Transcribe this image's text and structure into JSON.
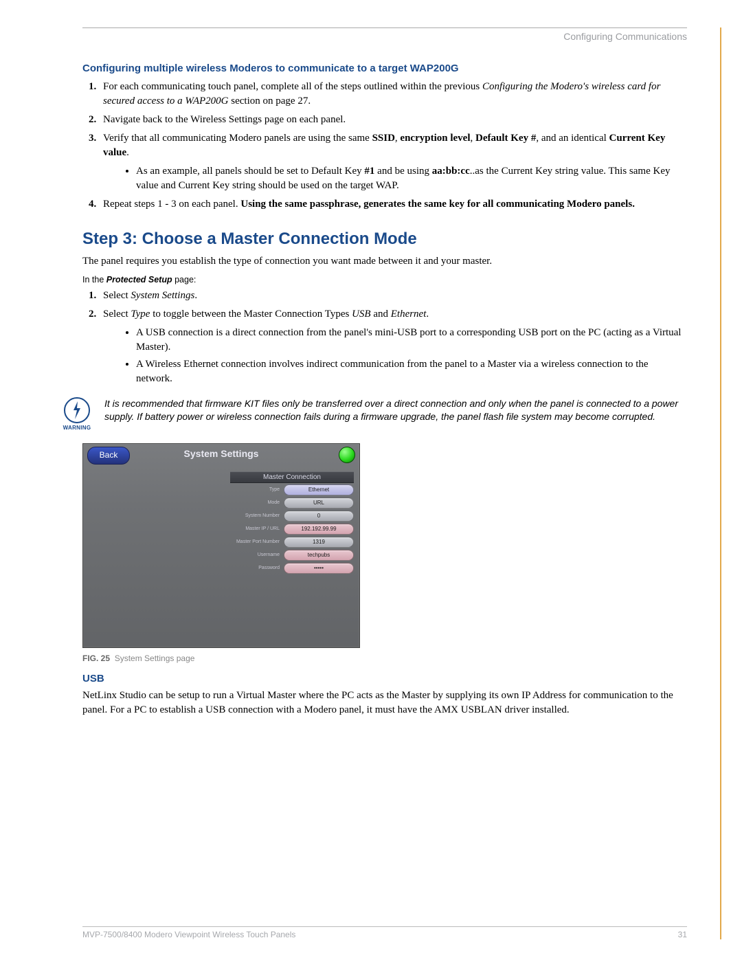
{
  "header": {
    "section": "Configuring Communications"
  },
  "headings": {
    "config_multi": "Configuring multiple wireless Moderos to communicate to a target WAP200G",
    "step3": "Step 3: Choose a Master Connection Mode",
    "usb": "USB"
  },
  "list1": {
    "item1_a": "For each communicating touch panel, complete all of the steps outlined within the previous ",
    "item1_b": "Configuring the Modero's wireless card for secured access to a WAP200G",
    "item1_c": " section on page 27.",
    "item2": "Navigate back to the Wireless Settings page on each panel.",
    "item3_a": "Verify that all communicating Modero panels are using the same ",
    "item3_b": "SSID",
    "item3_c": ", ",
    "item3_d": "encryption level",
    "item3_e": ", ",
    "item3_f": "Default Key #",
    "item3_g": ", and an identical ",
    "item3_h": "Current Key value",
    "item3_i": ".",
    "item3_bullet_a": "As an example, all panels should be set to Default Key ",
    "item3_bullet_b": "#1",
    "item3_bullet_c": " and be using ",
    "item3_bullet_d": "aa:bb:cc",
    "item3_bullet_e": "..as the Current Key string value. This same Key value and Current Key string should be used on the target WAP.",
    "item4_a": "Repeat steps 1 - 3 on each panel. ",
    "item4_b": "Using the same passphrase, generates the same key for all communicating Modero panels."
  },
  "step3_intro": "The panel requires you establish the type of connection you want made between it and your master.",
  "protected": {
    "pre": "In the ",
    "ital": "Protected Setup",
    "post": " page:"
  },
  "list2": {
    "item1_a": "Select ",
    "item1_b": "System Settings",
    "item1_c": ".",
    "item2_a": "Select ",
    "item2_b": "Type",
    "item2_c": " to toggle between the Master Connection Types ",
    "item2_d": "USB",
    "item2_e": " and ",
    "item2_f": "Ethernet",
    "item2_g": ".",
    "b1": "A USB connection is a direct connection from the panel's mini-USB port to a corresponding USB port on the PC (acting as a Virtual Master).",
    "b2": "A Wireless Ethernet connection involves indirect communication from the panel to a Master via a wireless connection to the network."
  },
  "warning": {
    "label": "WARNING",
    "text": "It is recommended that firmware KIT files only be transferred over a direct connection and only when the panel is connected to a power supply. If battery power or wireless connection fails during a firmware upgrade, the panel flash file system may become corrupted."
  },
  "screenshot": {
    "back": "Back",
    "title": "System Settings",
    "panel_header": "Master Connection",
    "rows": {
      "type": {
        "label": "Type",
        "value": "Ethernet"
      },
      "mode": {
        "label": "Mode",
        "value": "URL"
      },
      "sysnum": {
        "label": "System Number",
        "value": "0"
      },
      "ip": {
        "label": "Master IP / URL",
        "value": "192.192.99.99"
      },
      "port": {
        "label": "Master Port Number",
        "value": "1319"
      },
      "user": {
        "label": "Username",
        "value": "techpubs"
      },
      "pass": {
        "label": "Password",
        "value": "•••••"
      }
    }
  },
  "figure": {
    "num": "FIG. 25",
    "caption": "System Settings page"
  },
  "usb_para": "NetLinx Studio can be setup to run a Virtual Master where the PC acts as the Master by supplying its own IP Address for communication to the panel. For a PC to establish a USB connection with a Modero panel, it must have the AMX USBLAN driver installed.",
  "footer": {
    "left": "MVP-7500/8400 Modero Viewpoint Wireless Touch Panels",
    "right": "31"
  }
}
